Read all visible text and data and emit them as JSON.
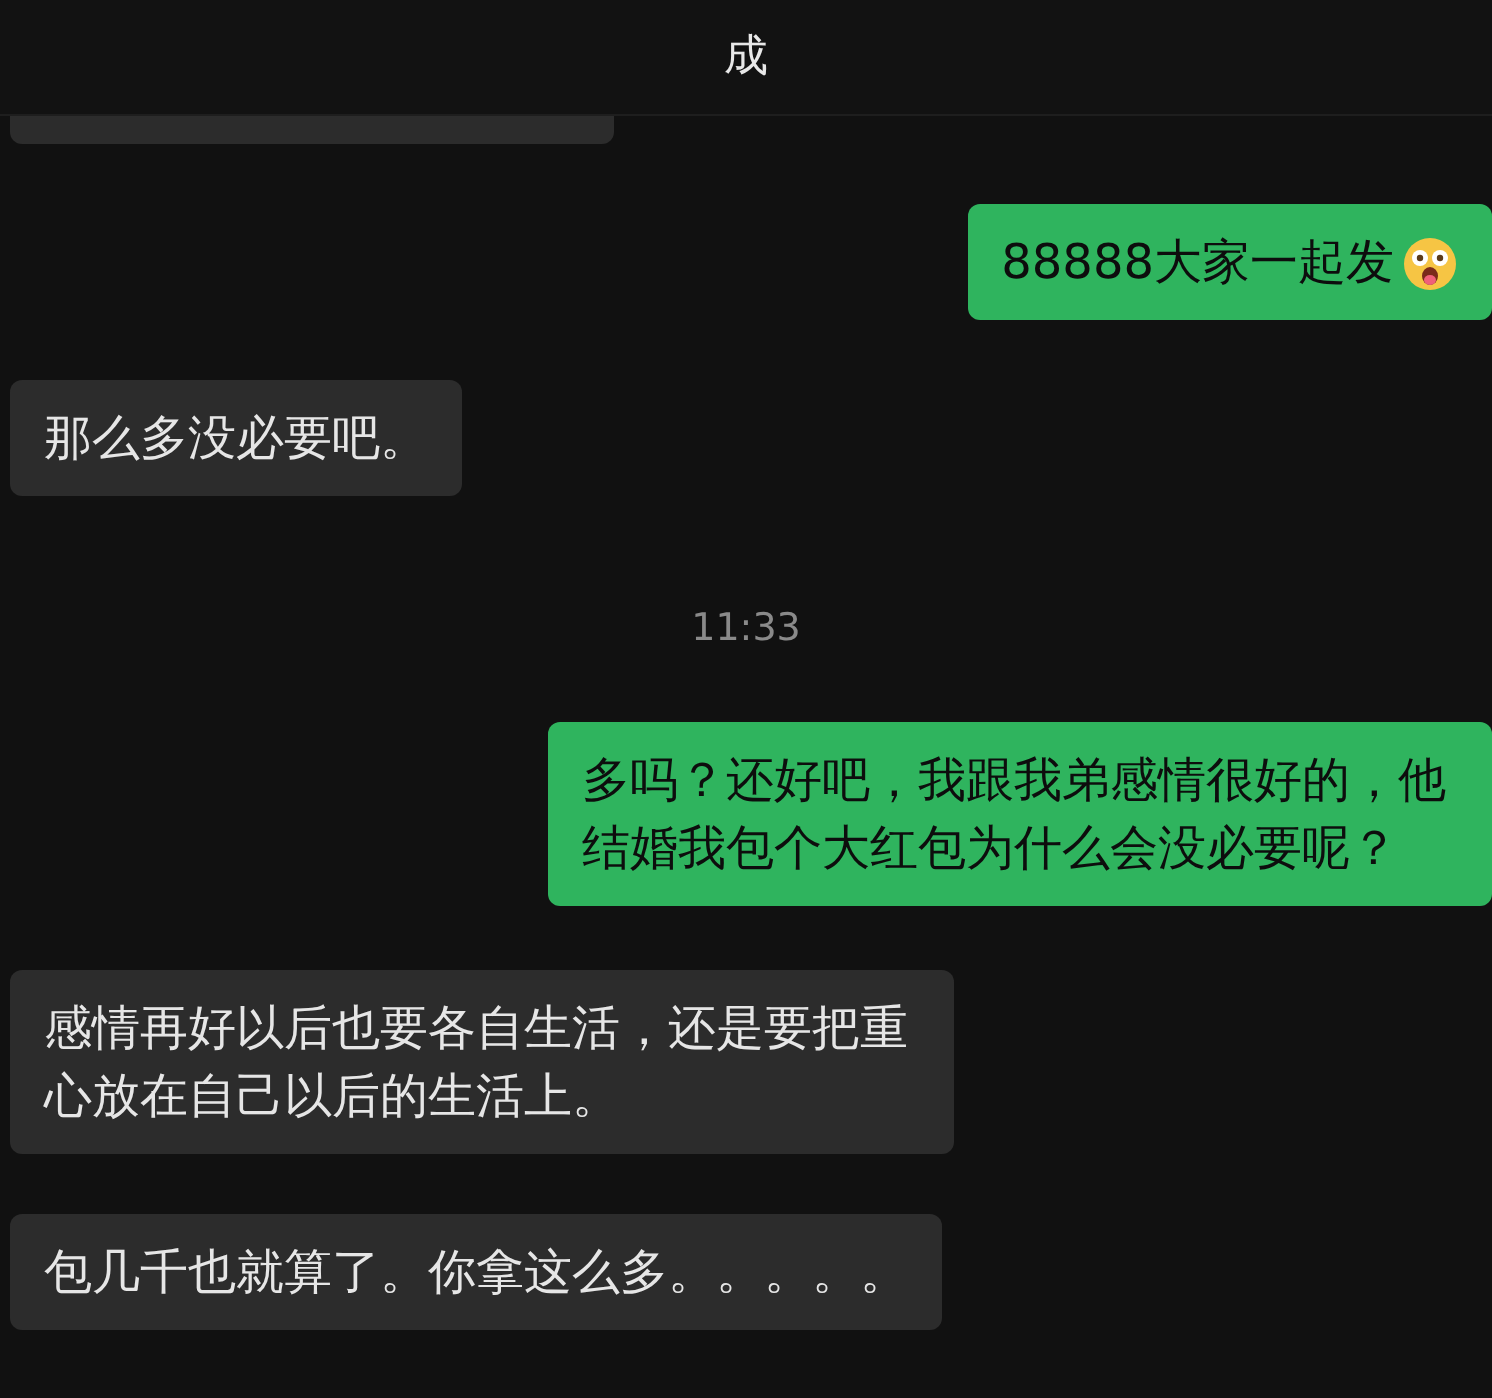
{
  "header": {
    "title": "成"
  },
  "messages": [
    {
      "kind": "partial"
    },
    {
      "kind": "outgoing",
      "text": "88888大家一起发",
      "emoji": true
    },
    {
      "kind": "incoming",
      "text": "那么多没必要吧。",
      "emoji": false
    },
    {
      "kind": "time",
      "text": "11:33"
    },
    {
      "kind": "outgoing",
      "text": "多吗？还好吧，我跟我弟感情很好的，他结婚我包个大红包为什么会没必要呢？",
      "emoji": false
    },
    {
      "kind": "incoming",
      "text": "感情再好以后也要各自生活，还是要把重心放在自己以后的生活上。",
      "emoji": false
    },
    {
      "kind": "incoming",
      "text": "包几千也就算了。你拿这么多。。。。。",
      "emoji": false
    }
  ]
}
